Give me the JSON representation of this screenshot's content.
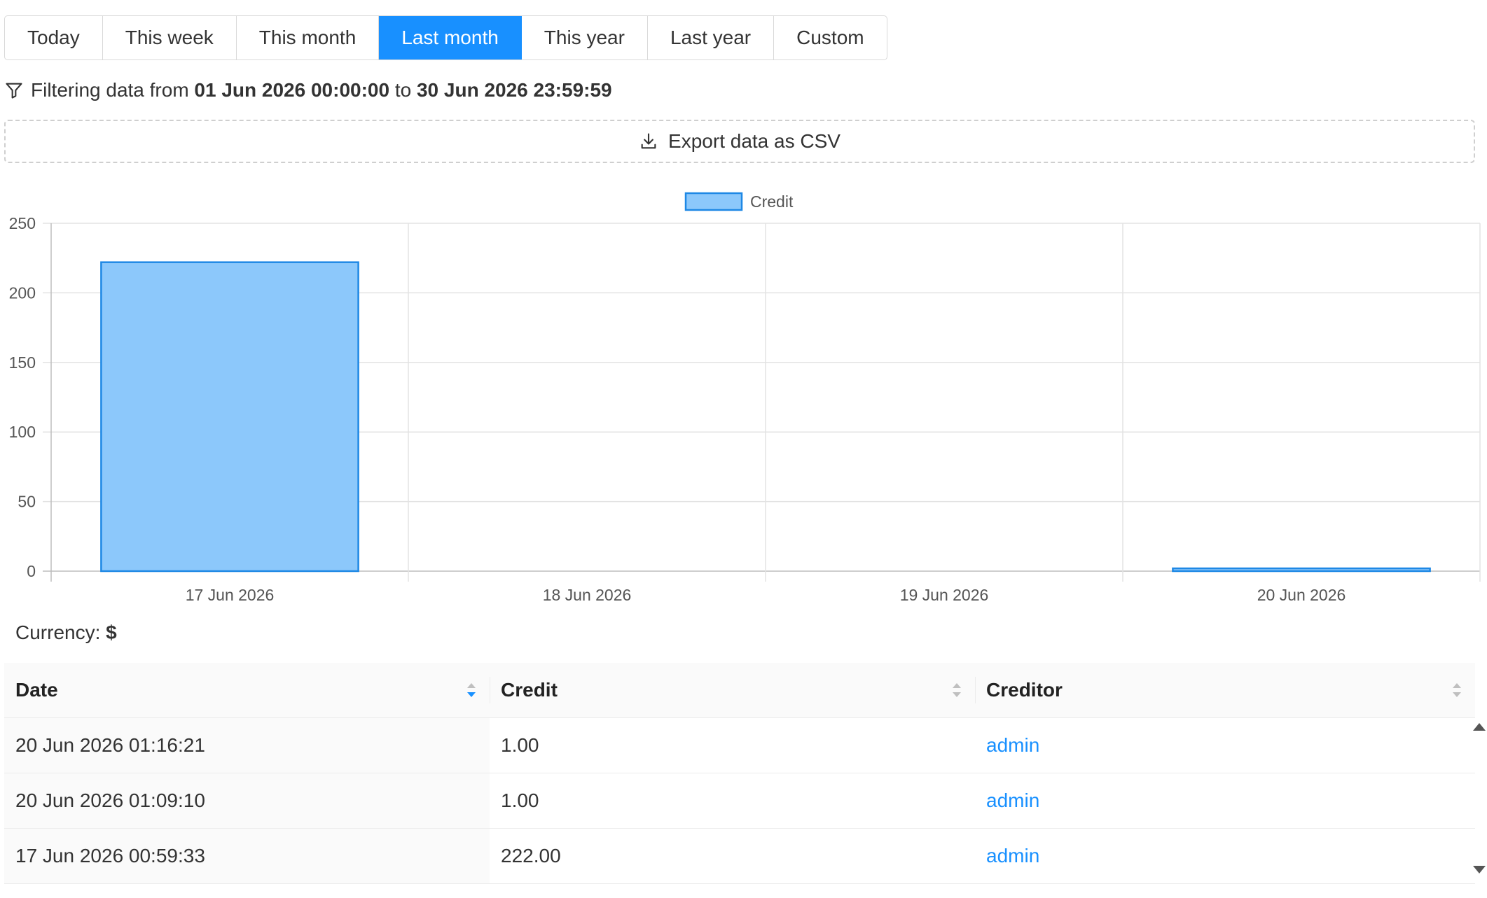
{
  "range_buttons": [
    {
      "label": "Today",
      "active": false
    },
    {
      "label": "This week",
      "active": false
    },
    {
      "label": "This month",
      "active": false
    },
    {
      "label": "Last month",
      "active": true
    },
    {
      "label": "This year",
      "active": false
    },
    {
      "label": "Last year",
      "active": false
    },
    {
      "label": "Custom",
      "active": false
    }
  ],
  "filter": {
    "prefix": "Filtering data from",
    "from": "01 Jun 2026 00:00:00",
    "joiner": "to",
    "to": "30 Jun 2026 23:59:59",
    "icon": "filter-icon"
  },
  "export": {
    "label": "Export data as CSV",
    "icon": "download-icon"
  },
  "chart_data": {
    "type": "bar",
    "categories": [
      "17 Jun 2026",
      "18 Jun 2026",
      "19 Jun 2026",
      "20 Jun 2026"
    ],
    "series": [
      {
        "name": "Credit",
        "values": [
          222,
          0,
          0,
          2
        ]
      }
    ],
    "ylim": [
      0,
      250
    ],
    "yticks": [
      0,
      50,
      100,
      150,
      200,
      250
    ],
    "legend": "top-center",
    "grid": true,
    "colors": {
      "fill": "#8cc8fb",
      "stroke": "#1e88e5"
    }
  },
  "currency": {
    "label": "Currency:",
    "symbol": "$"
  },
  "table": {
    "columns": [
      "Date",
      "Credit",
      "Creditor"
    ],
    "rows": [
      {
        "date": "20 Jun 2026 01:16:21",
        "credit": "1.00",
        "creditor": "admin"
      },
      {
        "date": "20 Jun 2026 01:09:10",
        "credit": "1.00",
        "creditor": "admin"
      },
      {
        "date": "17 Jun 2026 00:59:33",
        "credit": "222.00",
        "creditor": "admin"
      }
    ]
  }
}
